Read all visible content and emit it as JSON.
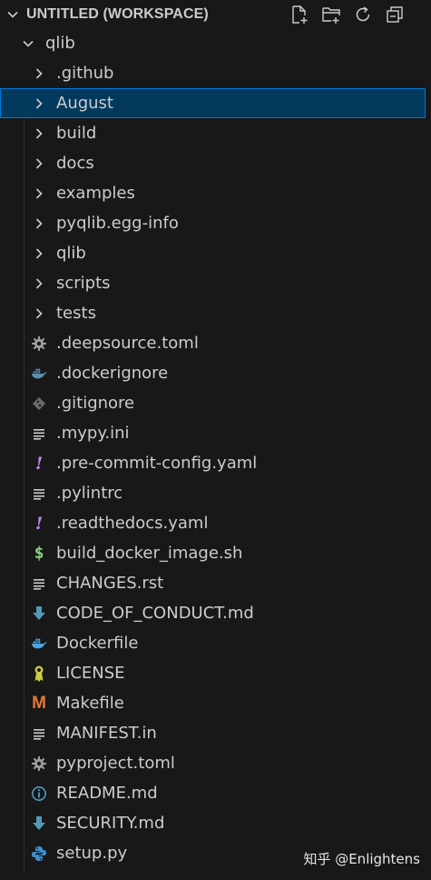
{
  "explorer": {
    "title": "UNTITLED (WORKSPACE)",
    "actions": [
      "new-file-icon",
      "new-folder-icon",
      "refresh-icon",
      "collapse-all-icon"
    ],
    "root": {
      "label": "qlib",
      "expanded": true
    },
    "folders": [
      ".github",
      "August",
      "build",
      "docs",
      "examples",
      "pyqlib.egg-info",
      "qlib",
      "scripts",
      "tests"
    ],
    "selected": "August",
    "files": [
      {
        "label": ".deepsource.toml",
        "icon": "gear-icon"
      },
      {
        "label": ".dockerignore",
        "icon": "docker-icon"
      },
      {
        "label": ".gitignore",
        "icon": "git-icon"
      },
      {
        "label": ".mypy.ini",
        "icon": "lines-icon"
      },
      {
        "label": ".pre-commit-config.yaml",
        "icon": "yaml-icon"
      },
      {
        "label": ".pylintrc",
        "icon": "lines-icon"
      },
      {
        "label": ".readthedocs.yaml",
        "icon": "yaml-icon"
      },
      {
        "label": "build_docker_image.sh",
        "icon": "shell-icon"
      },
      {
        "label": "CHANGES.rst",
        "icon": "lines-icon"
      },
      {
        "label": "CODE_OF_CONDUCT.md",
        "icon": "markdown-icon"
      },
      {
        "label": "Dockerfile",
        "icon": "docker-icon"
      },
      {
        "label": "LICENSE",
        "icon": "license-icon"
      },
      {
        "label": "Makefile",
        "icon": "makefile-icon"
      },
      {
        "label": "MANIFEST.in",
        "icon": "lines-icon"
      },
      {
        "label": "pyproject.toml",
        "icon": "gear-icon"
      },
      {
        "label": "README.md",
        "icon": "info-icon"
      },
      {
        "label": "SECURITY.md",
        "icon": "markdown-icon"
      },
      {
        "label": "setup.py",
        "icon": "python-icon"
      }
    ]
  },
  "watermark": "知乎 @Enlightens",
  "colors": {
    "background": "#181818",
    "selection": "#04395e",
    "selection_border": "#0078d4",
    "text": "#cccccc"
  }
}
